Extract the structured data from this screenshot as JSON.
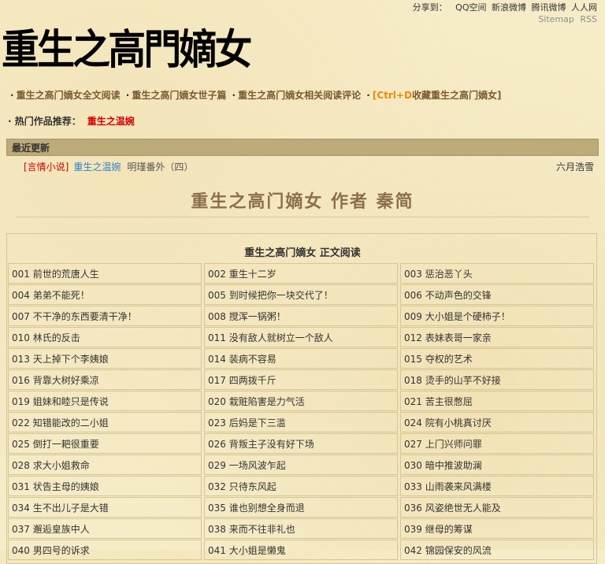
{
  "header": {
    "share_label": "分享到：",
    "share_links": [
      "QQ空间",
      "新浪微博",
      "腾讯微博",
      "人人网"
    ],
    "sitemap_links": [
      "Sitemap",
      "RSS"
    ]
  },
  "logo_text": "重生之高門嫡女",
  "nav": {
    "links": [
      "重生之高门嫡女全文阅读",
      "重生之高门嫡女世子篇",
      "重生之高门嫡女相关阅读评论"
    ],
    "bookmark_prefix": "[",
    "bookmark_key": "Ctrl+D",
    "bookmark_text": "收藏重生之高门嫡女",
    "bookmark_suffix": "]",
    "hot_label": "· 热门作品推荐：",
    "hot_link": "重生之温婉"
  },
  "recent": {
    "title": "最近更新",
    "category": "[言情小说]",
    "book": "重生之温婉",
    "chapter": "明瑾番外（四）",
    "author": "六月浩雪"
  },
  "book_title": "重生之高门嫡女  作者  秦简",
  "toc": {
    "title": "重生之高门嫡女 正文阅读",
    "chapters": [
      "001 前世的荒唐人生",
      "002 重生十二岁",
      "003 惩治恶丫头",
      "004 弟弟不能死！",
      "005 到时候把你一块交代了！",
      "006 不动声色的交锋",
      "007 不干净的东西要清干净！",
      "008 搅浑一锅粥！",
      "009 大小姐是个硬柿子！",
      "010 林氏的反击",
      "011 没有敌人就树立一个敌人",
      "012 表妹表哥一家亲",
      "013 天上掉下个李姨娘",
      "014 装病不容易",
      "015 夺权的艺术",
      "016 背靠大树好乘凉",
      "017 四两拨千斤",
      "018 烫手的山芋不好接",
      "019 姐妹和睦只是传说",
      "020 栽赃陷害是力气活",
      "021 苦主很憋屈",
      "022 知错能改的二小姐",
      "023 后妈是下三滥",
      "024 院有小桃真讨厌",
      "025 倒打一耙很重要",
      "026 背叛主子没有好下场",
      "027 上门兴师问罪",
      "028 求大小姐救命",
      "029 一场风波乍起",
      "030 暗中推波助澜",
      "031 状告主母的姨娘",
      "032 只待东风起",
      "033 山雨袭来风满楼",
      "034 生不出儿子是大错",
      "035 谁也别想全身而退",
      "036 风姿绝世无人能及",
      "037 邂逅皇族中人",
      "038 来而不往非礼也",
      "039 继母的筹谋",
      "040 男四号的诉求",
      "041 大小姐是懒鬼",
      "042 锦园保安的风流"
    ]
  }
}
